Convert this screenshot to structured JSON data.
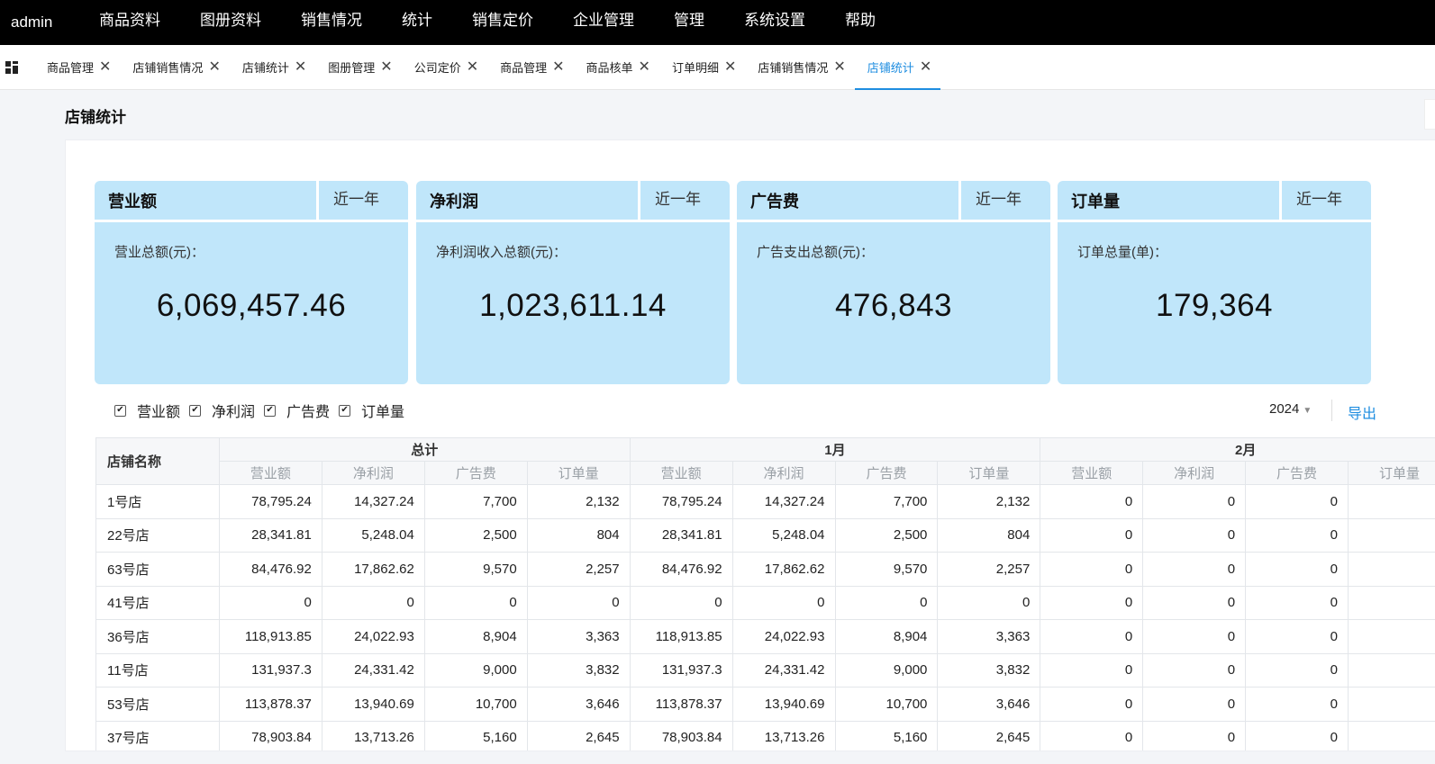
{
  "topbar": {
    "user": "admin",
    "menu": [
      "商品资料",
      "图册资料",
      "销售情况",
      "统计",
      "销售定价",
      "企业管理",
      "管理",
      "系统设置",
      "帮助"
    ]
  },
  "tabs": [
    {
      "label": "商品管理",
      "active": false
    },
    {
      "label": "店铺销售情况",
      "active": false
    },
    {
      "label": "店铺统计",
      "active": false
    },
    {
      "label": "图册管理",
      "active": false
    },
    {
      "label": "公司定价",
      "active": false
    },
    {
      "label": "商品管理",
      "active": false
    },
    {
      "label": "商品核单",
      "active": false
    },
    {
      "label": "订单明细",
      "active": false
    },
    {
      "label": "店铺销售情况",
      "active": false
    },
    {
      "label": "店铺统计",
      "active": true
    }
  ],
  "page": {
    "title": "店铺统计"
  },
  "cards": [
    {
      "name": "营业额",
      "period": "近一年",
      "label": "营业总额(元)：",
      "value": "6,069,457.46"
    },
    {
      "name": "净利润",
      "period": "近一年",
      "label": "净利润收入总额(元)：",
      "value": "1,023,611.14"
    },
    {
      "name": "广告费",
      "period": "近一年",
      "label": "广告支出总额(元)：",
      "value": "476,843"
    },
    {
      "name": "订单量",
      "period": "近一年",
      "label": "订单总量(单)：",
      "value": "179,364"
    }
  ],
  "filters": {
    "options": [
      {
        "label": "营业额",
        "checked": true
      },
      {
        "label": "净利润",
        "checked": true
      },
      {
        "label": "广告费",
        "checked": true
      },
      {
        "label": "订单量",
        "checked": true
      }
    ],
    "year": "2024",
    "export": "导出"
  },
  "table": {
    "corner": "店铺名称",
    "groups": [
      "总计",
      "1月",
      "2月"
    ],
    "subheaders": [
      "营业额",
      "净利润",
      "广告费",
      "订单量"
    ],
    "rows": [
      {
        "store": "1号店",
        "cells": [
          "78,795.24",
          "14,327.24",
          "7,700",
          "2,132",
          "78,795.24",
          "14,327.24",
          "7,700",
          "2,132",
          "0",
          "0",
          "0"
        ]
      },
      {
        "store": "22号店",
        "cells": [
          "28,341.81",
          "5,248.04",
          "2,500",
          "804",
          "28,341.81",
          "5,248.04",
          "2,500",
          "804",
          "0",
          "0",
          "0"
        ]
      },
      {
        "store": "63号店",
        "cells": [
          "84,476.92",
          "17,862.62",
          "9,570",
          "2,257",
          "84,476.92",
          "17,862.62",
          "9,570",
          "2,257",
          "0",
          "0",
          "0"
        ]
      },
      {
        "store": "41号店",
        "cells": [
          "0",
          "0",
          "0",
          "0",
          "0",
          "0",
          "0",
          "0",
          "0",
          "0",
          "0"
        ]
      },
      {
        "store": "36号店",
        "cells": [
          "118,913.85",
          "24,022.93",
          "8,904",
          "3,363",
          "118,913.85",
          "24,022.93",
          "8,904",
          "3,363",
          "0",
          "0",
          "0"
        ]
      },
      {
        "store": "11号店",
        "cells": [
          "131,937.3",
          "24,331.42",
          "9,000",
          "3,832",
          "131,937.3",
          "24,331.42",
          "9,000",
          "3,832",
          "0",
          "0",
          "0"
        ]
      },
      {
        "store": "53号店",
        "cells": [
          "113,878.37",
          "13,940.69",
          "10,700",
          "3,646",
          "113,878.37",
          "13,940.69",
          "10,700",
          "3,646",
          "0",
          "0",
          "0"
        ]
      },
      {
        "store": "37号店",
        "cells": [
          "78,903.84",
          "13,713.26",
          "5,160",
          "2,645",
          "78,903.84",
          "13,713.26",
          "5,160",
          "2,645",
          "0",
          "0",
          "0"
        ]
      }
    ]
  }
}
